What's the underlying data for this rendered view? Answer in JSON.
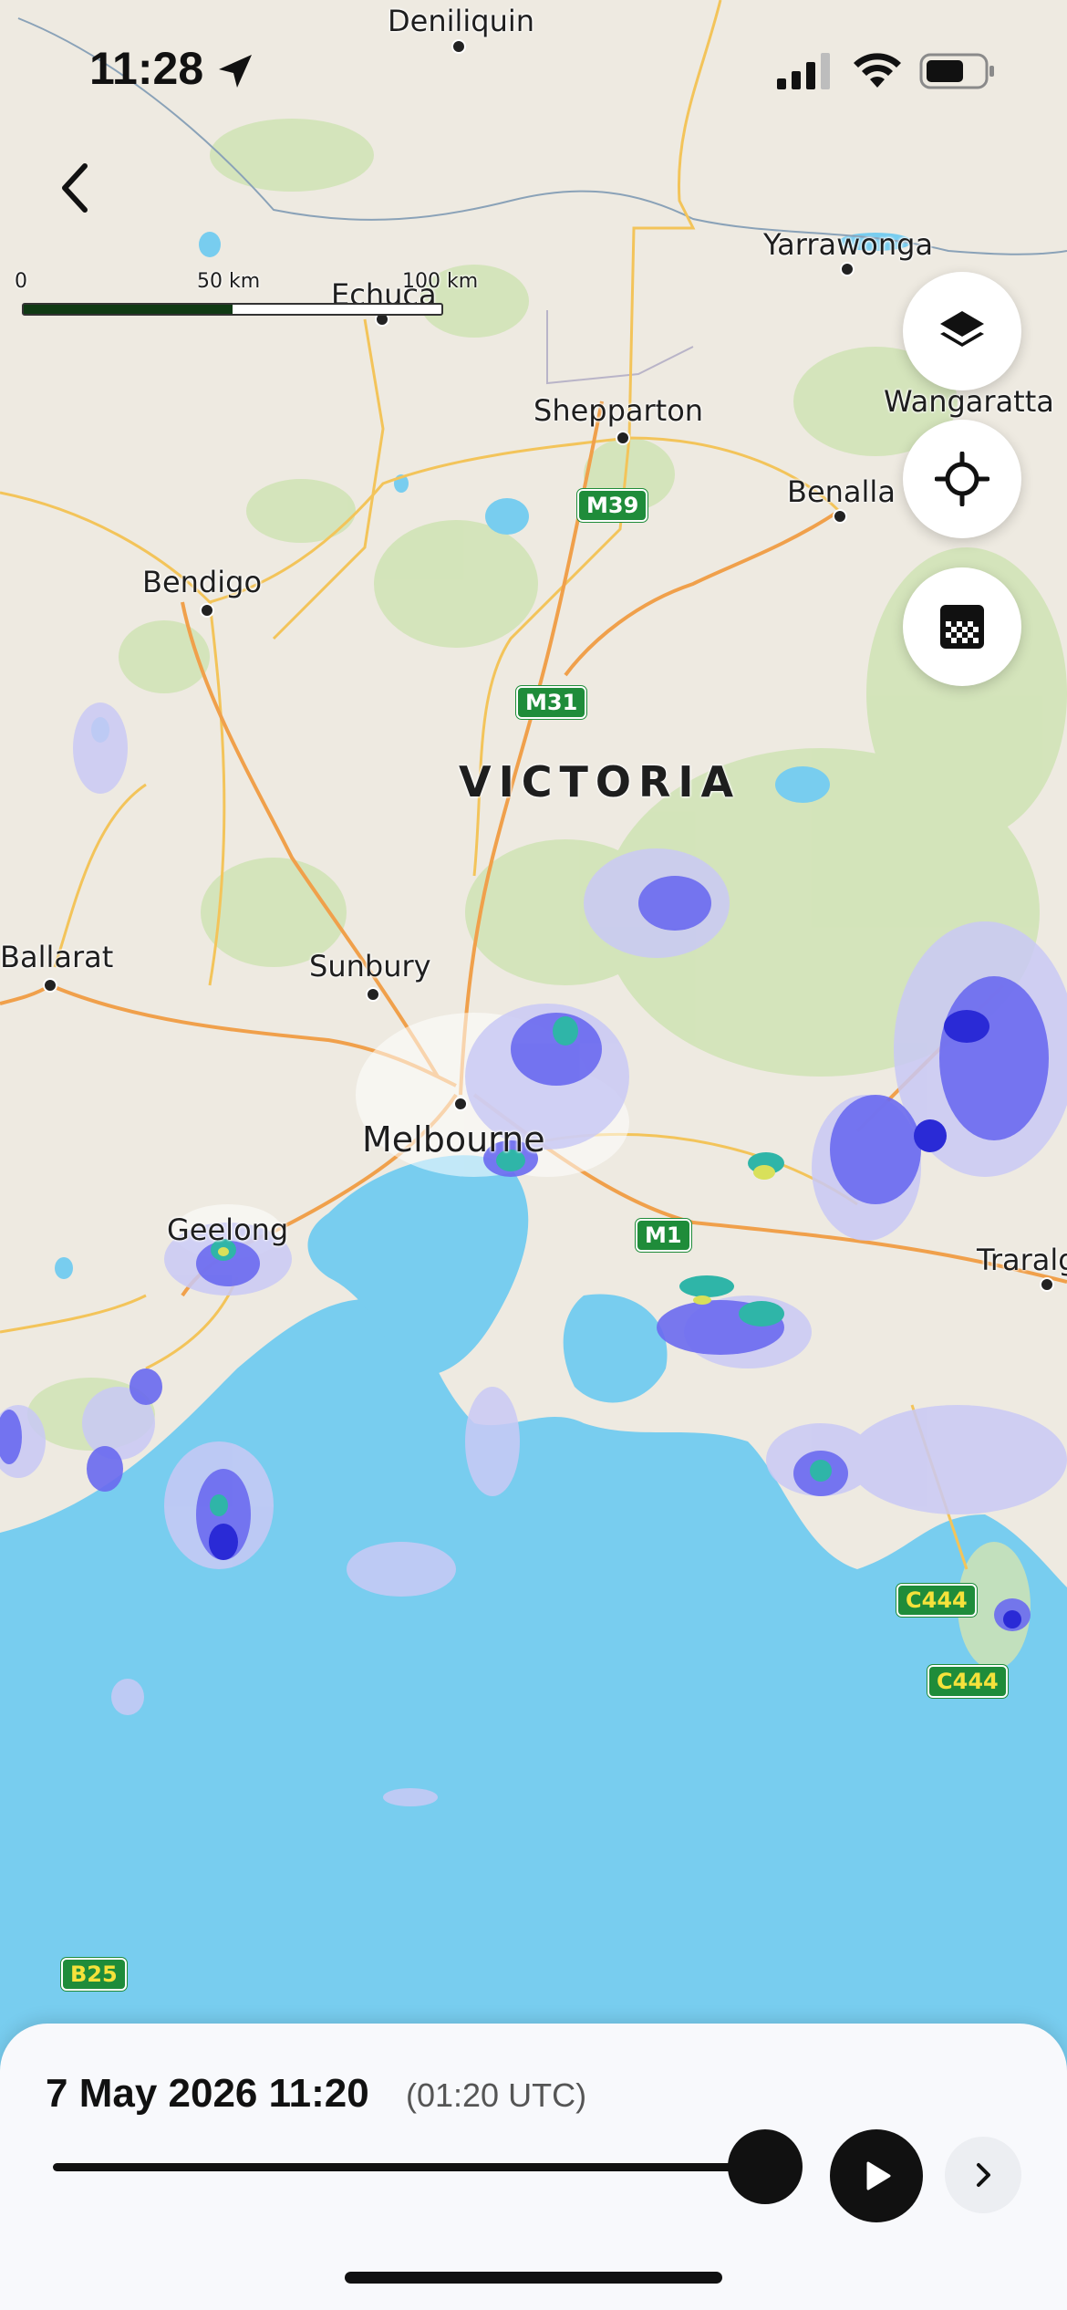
{
  "status_bar": {
    "time": "11:28"
  },
  "map": {
    "state_label": "VICTORIA",
    "places": [
      {
        "name": "Deniliquin"
      },
      {
        "name": "Yarrawonga"
      },
      {
        "name": "Echuca"
      },
      {
        "name": "Wangaratta"
      },
      {
        "name": "Shepparton"
      },
      {
        "name": "Benalla"
      },
      {
        "name": "Bendigo"
      },
      {
        "name": "Ballarat"
      },
      {
        "name": "Sunbury"
      },
      {
        "name": "Melbourne"
      },
      {
        "name": "Geelong"
      },
      {
        "name": "Traralg"
      }
    ],
    "road_shields": [
      "M39",
      "M31",
      "M1",
      "C444",
      "C444",
      "B25"
    ],
    "scale": {
      "zero": "0",
      "mid": "50 km",
      "max": "100 km"
    }
  },
  "controls": {
    "icons": [
      "layers-icon",
      "locate-icon",
      "legend-icon",
      "back-icon"
    ]
  },
  "timeline": {
    "date_time": "7 May 2026 11:20",
    "utc": "(01:20 UTC)",
    "progress": 1.0
  },
  "colors": {
    "land": "#eeeae1",
    "water": "#78cdef",
    "park": "#cfe3b4",
    "road_major": "#f0a04b",
    "road_minor": "#f3c45a",
    "shield": "#1f8c3a",
    "radar_light": "#c9c9f5",
    "radar_mid": "#6a6af0",
    "radar_heavy": "#2a2ad6",
    "radar_teal": "#2fb5a8",
    "radar_yellow": "#d8e05a"
  }
}
